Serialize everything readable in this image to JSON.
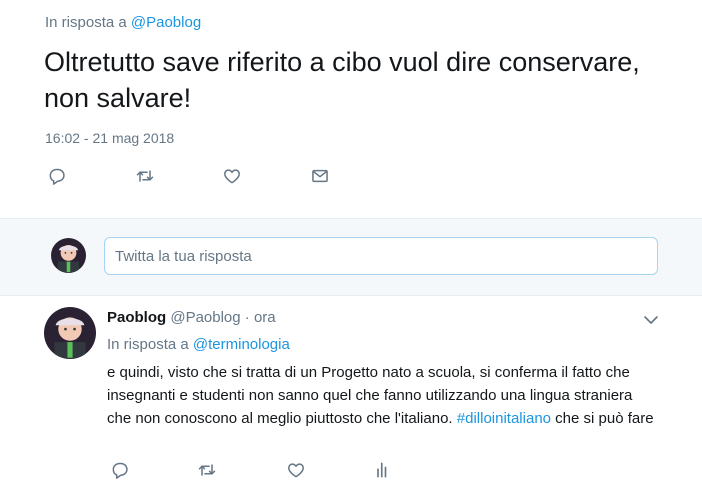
{
  "main_tweet": {
    "reply_prefix": "In risposta a",
    "reply_handle": "@Paoblog",
    "text": "Oltretutto save riferito a cibo vuol dire conservare, non salvare!",
    "timestamp": "16:02 - 21 mag 2018"
  },
  "reply_box": {
    "placeholder": "Twitta la tua risposta"
  },
  "reply_tweet": {
    "name": "Paoblog",
    "handle": "@Paoblog",
    "separator": "·",
    "time": "ora",
    "reply_prefix": "In risposta a",
    "reply_handle": "@terminologia",
    "text_before": "e quindi, visto che si tratta di un Progetto nato a scuola, si conferma il fatto che insegnanti e studenti non sanno quel che fanno utilizzando una lingua straniera che non conoscono al meglio piuttosto che l'italiano. ",
    "hashtag": "#dilloinitaliano",
    "text_after": " che si può fare"
  },
  "icons": {
    "reply": "reply-icon",
    "retweet": "retweet-icon",
    "like": "heart-icon",
    "dm": "mail-icon",
    "analytics": "analytics-icon",
    "more": "chevron-down-icon"
  },
  "colors": {
    "link": "#1b95e0",
    "muted": "#657786",
    "text": "#14171a",
    "reply_bg": "#f5f8fa",
    "input_border": "#a6d4f2"
  }
}
